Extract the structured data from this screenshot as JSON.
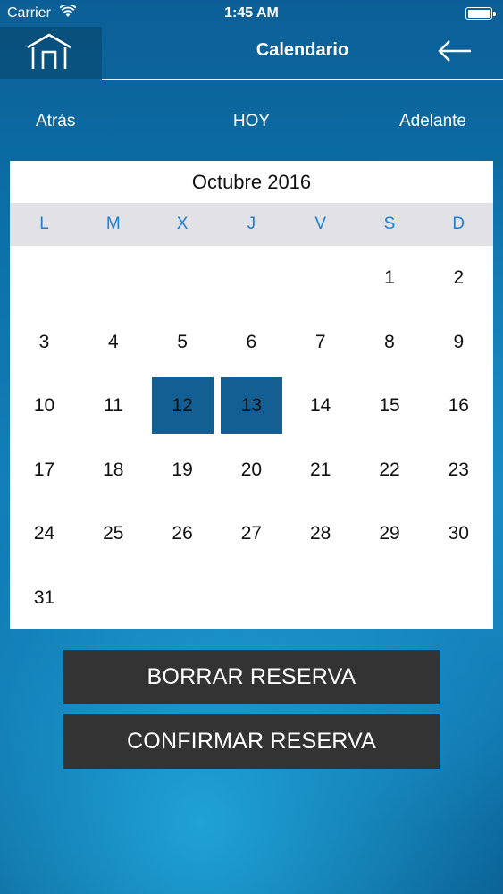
{
  "status_bar": {
    "carrier": "Carrier",
    "time": "1:45 AM"
  },
  "nav": {
    "title": "Calendario",
    "home_icon": "home-icon",
    "back_icon": "back-arrow-icon"
  },
  "date_nav": {
    "prev": "Atrás",
    "today": "HOY",
    "next": "Adelante"
  },
  "calendar": {
    "month_title": "Octubre 2016",
    "weekdays": [
      "L",
      "M",
      "X",
      "J",
      "V",
      "S",
      "D"
    ],
    "first_weekday_index": 5,
    "days_in_month": 31,
    "selected_days": [
      12,
      13
    ],
    "selected_color": "#135f94",
    "weekday_color": "#1e7fd9"
  },
  "actions": {
    "delete_label": "BORRAR RESERVA",
    "confirm_label": "CONFIRMAR RESERVA"
  }
}
